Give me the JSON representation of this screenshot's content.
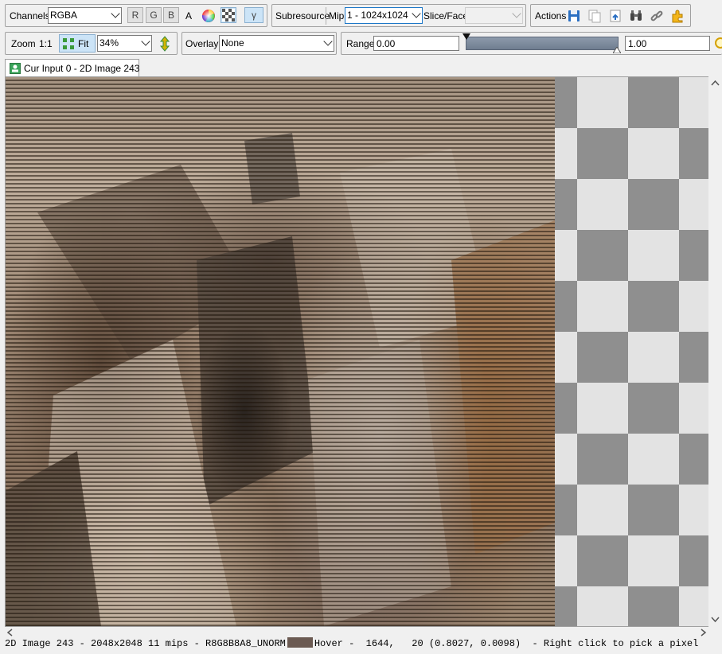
{
  "toolbar1": {
    "channels_label": "Channels",
    "channels_value": "RGBA",
    "r": "R",
    "g": "G",
    "b": "B",
    "a": "A",
    "gamma": "γ",
    "subresource_label": "Subresource",
    "mip_label": "Mip",
    "mip_value": "1 - 1024x1024",
    "slice_label": "Slice/Face",
    "slice_value": "",
    "actions_label": "Actions",
    "action_icons": [
      "save-icon",
      "copy-icon",
      "open-icon",
      "binoculars-icon",
      "link-icon",
      "settings-puzzle-icon"
    ]
  },
  "toolbar2": {
    "zoom_label": "Zoom",
    "one_to_one": "1:1",
    "fit_label": "Fit",
    "zoom_value": "34%",
    "overlay_label": "Overlay",
    "overlay_value": "None",
    "range_label": "Range",
    "range_min": "0.00",
    "range_max": "1.00"
  },
  "tab": {
    "label": "Cur Input 0 - 2D Image 243"
  },
  "status": {
    "left": "2D Image 243 - 2048x2048 11 mips - R8G8B8A8_UNORM",
    "swatch_color": "#6b5a52",
    "right": "Hover -  1644,   20 (0.8027, 0.0098)  - Right click to pick a pixel"
  },
  "colors": {
    "checker_dark": "#8f8f8f",
    "checker_light": "#e3e3e3",
    "accent": "#1e78c8"
  }
}
